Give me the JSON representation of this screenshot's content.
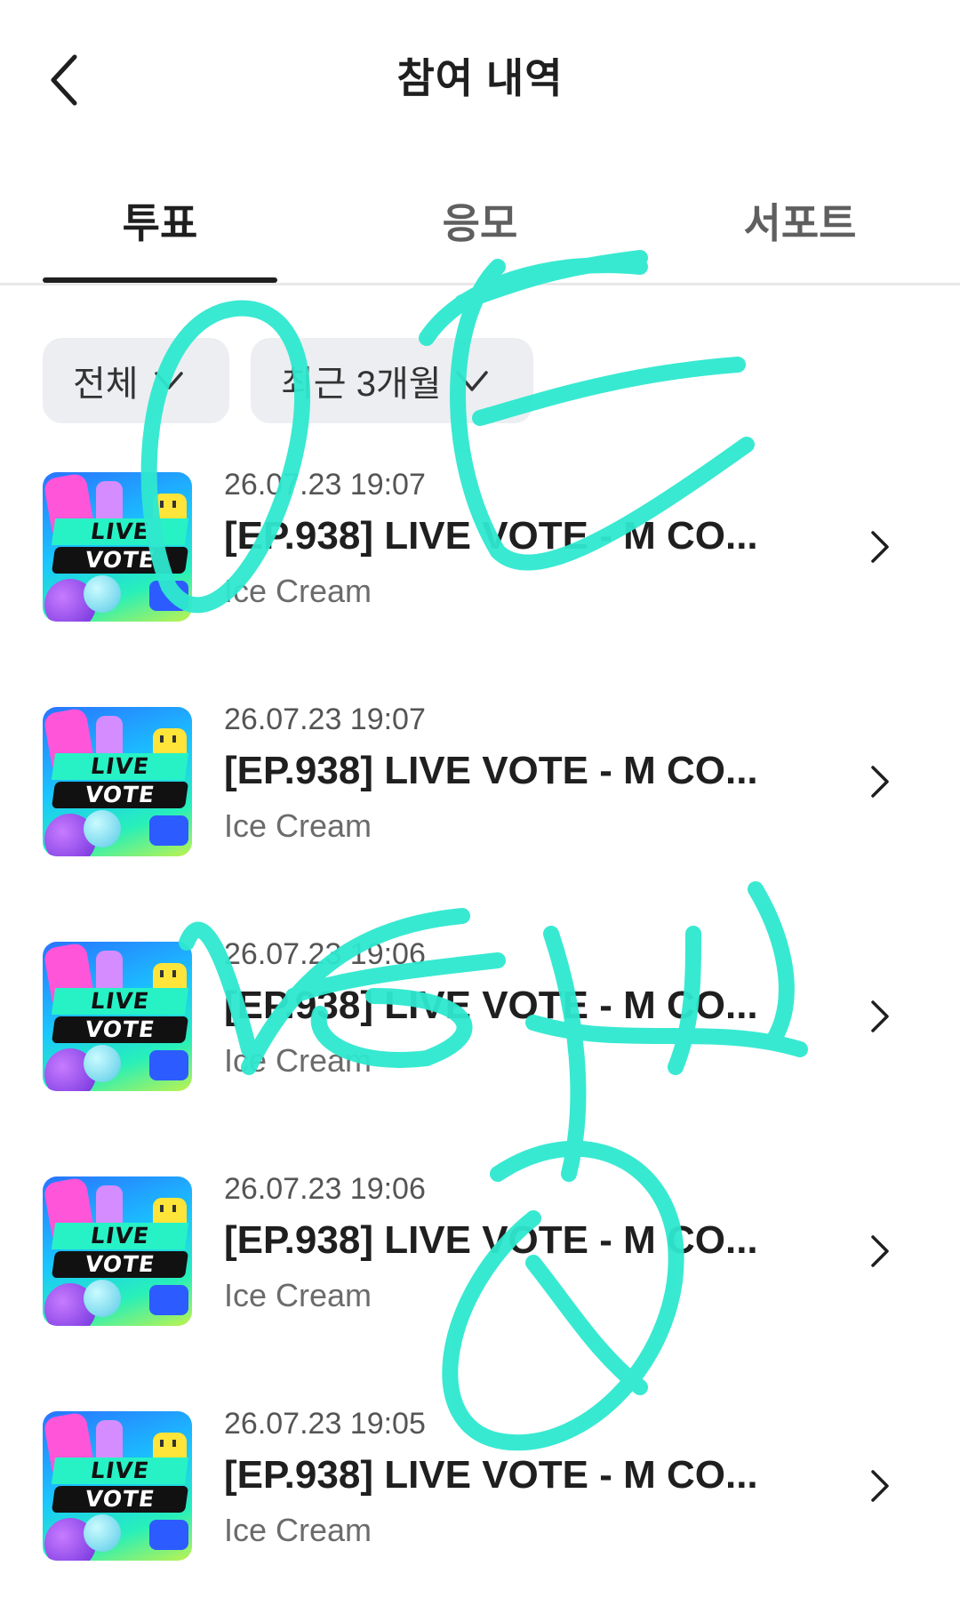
{
  "header": {
    "title": "참여 내역",
    "back_icon": "chevron-left-icon"
  },
  "tabs": [
    {
      "label": "투표",
      "active": true
    },
    {
      "label": "응모",
      "active": false
    },
    {
      "label": "서포트",
      "active": false
    }
  ],
  "filters": [
    {
      "label": "전체",
      "icon": "chevron-down-icon"
    },
    {
      "label": "최근 3개월",
      "icon": "chevron-down-icon"
    }
  ],
  "thumbnail_text": {
    "line1": "LIVE",
    "line2": "VOTE"
  },
  "items": [
    {
      "date": "26.07.23 19:07",
      "title": "[EP.938] LIVE VOTE - M CO...",
      "subtitle": "Ice Cream"
    },
    {
      "date": "26.07.23 19:07",
      "title": "[EP.938] LIVE VOTE - M CO...",
      "subtitle": "Ice Cream"
    },
    {
      "date": "26.07.23 19:06",
      "title": "[EP.938] LIVE VOTE - M CO...",
      "subtitle": "Ice Cream"
    },
    {
      "date": "26.07.23 19:06",
      "title": "[EP.938] LIVE VOTE - M CO...",
      "subtitle": "Ice Cream"
    },
    {
      "date": "26.07.23 19:05",
      "title": "[EP.938] LIVE VOTE - M CO...",
      "subtitle": "Ice Cream"
    }
  ],
  "colors": {
    "text": "#1f1f1f",
    "chip_bg": "#eceef1",
    "watermark": "#2ee8cf"
  }
}
